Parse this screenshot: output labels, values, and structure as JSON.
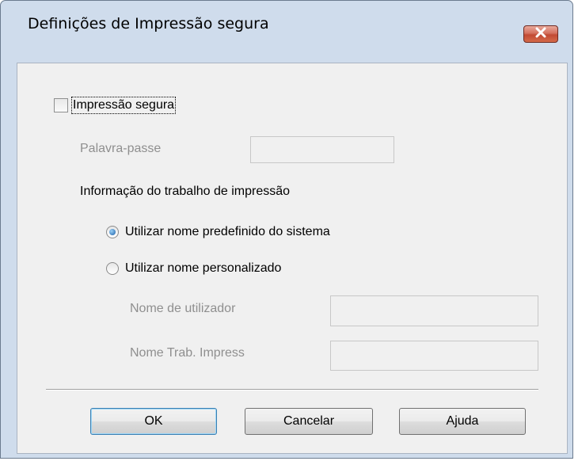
{
  "window": {
    "title": "Definições de Impressão segura",
    "close_icon": "close-icon"
  },
  "secure_print": {
    "checkbox_label": "Impressão segura",
    "checked": false,
    "password_label": "Palavra-passe",
    "password_value": ""
  },
  "job_info": {
    "group_label": "Informação do trabalho de impressão",
    "options": [
      {
        "label": "Utilizar nome predefinido do sistema",
        "selected": true
      },
      {
        "label": "Utilizar nome personalizado",
        "selected": false
      }
    ],
    "username_label": "Nome de utilizador",
    "username_value": "",
    "jobname_label": "Nome Trab. Impress",
    "jobname_value": ""
  },
  "buttons": {
    "ok": "OK",
    "cancel": "Cancelar",
    "help": "Ajuda"
  },
  "colors": {
    "frame": "#cfdcec",
    "client": "#f0f0f0",
    "close_button": "#c24a34",
    "disabled_text": "#8f8f8f"
  }
}
